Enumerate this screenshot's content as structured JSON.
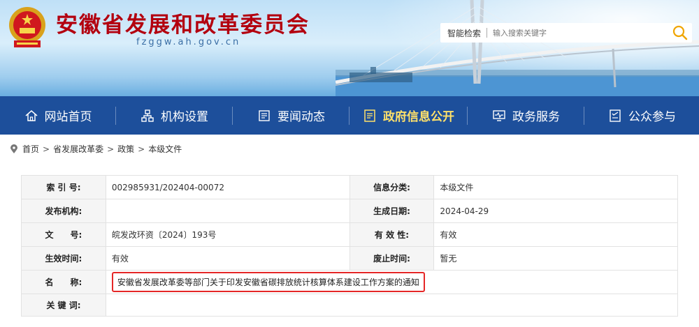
{
  "header": {
    "title": "安徽省发展和改革委员会",
    "domain": "fzggw.ah.gov.cn",
    "search_label": "智能检索",
    "search_placeholder": "输入搜索关键字"
  },
  "nav": {
    "items": [
      {
        "label": "网站首页",
        "icon": "home-icon"
      },
      {
        "label": "机构设置",
        "icon": "org-chart-icon"
      },
      {
        "label": "要闻动态",
        "icon": "news-icon"
      },
      {
        "label": "政府信息公开",
        "icon": "document-icon"
      },
      {
        "label": "政务服务",
        "icon": "monitor-icon"
      },
      {
        "label": "公众参与",
        "icon": "feedback-icon"
      }
    ]
  },
  "breadcrumb": {
    "items": [
      "首页",
      "省发展改革委",
      "政策",
      "本级文件"
    ],
    "sep": ">"
  },
  "info": {
    "index_label": "索 引 号:",
    "index_value": "002985931/202404-00072",
    "category_label": "信息分类:",
    "category_value": "本级文件",
    "issuer_label": "发布机构:",
    "issuer_value": "",
    "date_label": "生成日期:",
    "date_value": "2024-04-29",
    "docno_label": "文　　号:",
    "docno_value": "皖发改环资〔2024〕193号",
    "validity_label": "有 效 性:",
    "validity_value": "有效",
    "effective_label": "生效时间:",
    "effective_value": "有效",
    "abolish_label": "废止时间:",
    "abolish_value": "暂无",
    "name_label": "名　　称:",
    "name_value": "安徽省发展改革委等部门关于印发安徽省碳排放统计核算体系建设工作方案的通知",
    "keywords_label": "关 键 词:",
    "keywords_value": ""
  },
  "colors": {
    "nav_bg": "#1d4f9b",
    "nav_active": "#ffe16a",
    "title_red": "#b3000f",
    "highlight_border": "#e52727"
  }
}
